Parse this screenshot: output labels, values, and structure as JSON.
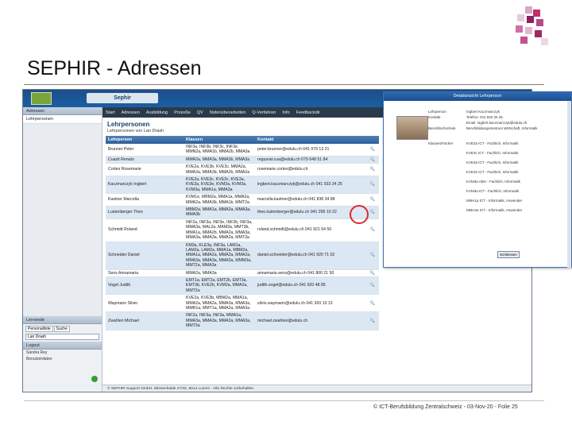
{
  "slide": {
    "title": "SEPHIR - Adressen",
    "footer": "© ICT-Berufsbildung Zentralschweiz - 03-Nov-20 - Folie 25"
  },
  "app": {
    "brand": "Sephir",
    "menu": [
      "Start",
      "Adressen",
      "Ausbildung",
      "Prozeße",
      "QV",
      "Notenüberarbeiten",
      "Q-Verfahren",
      "Info",
      "Feedbackdir"
    ],
    "left_header_addresses": "Adressen",
    "left_item": "Lehrpersonen",
    "left_header_lernende": "Lernende",
    "left_tabs": [
      "Personalliste",
      "Suche"
    ],
    "left_select_value": "Lan Drash",
    "left_header_logout": "Logout",
    "left_small_1": "Sandra Rey",
    "left_small_2": "Benutzerdaten",
    "content_title": "Lehrpersonen",
    "content_subtitle": "Lehrpersonen von Lan Drash",
    "table_headers": [
      "Lehrperson",
      "Klassen",
      "Kontakt",
      ""
    ],
    "rows": [
      {
        "name": "Brunner Peter",
        "klassen": "INF3a, INF3b, INF3c, INF3e, MMN2a, MMA1b, MMA2b, MMA3a",
        "kontakt": "peter.brunner@edulu.ch 041 979 13 21"
      },
      {
        "name": "Cuazit Renato",
        "klassen": "MMA2a, MMA3a, MMA3b, MMA3a",
        "kontakt": "regusrat.cua@edulu.ch 079 648 51 84"
      },
      {
        "name": "Cortes Rosemarie",
        "klassen": "KVE2a, KVE3b, KVE3c, MMA2a, MMA3a, MMA3b, MMA2b, MMA2a",
        "kontakt": "rosemarie.cortes@edulu.ch"
      },
      {
        "name": "Kaczmarczyk Ingbert",
        "klassen": "KVE2a, KVE3c, KVE3c, KVE3a, KVE3a, KVE3e, KVM3a, KVM3a, KVM3a, MMA1a, MMA3a",
        "kontakt": "ingbert.kaczmarczyk@edulu.ch 041 933 34 25"
      },
      {
        "name": "Kastner Marcella",
        "klassen": "KVM1e, MBM2a, MMA1a, MMA2a, MMA2a, MMA3b, MMA1b, MMT2a",
        "kontakt": "marcella.kastner@edulu.ch 041 838 34 88"
      },
      {
        "name": "Lustenberger Theo",
        "klassen": "MBM2a, MMA1a, MMA2a, MMA3a, MMA3b",
        "kontakt": "theo.lustenberger@edulu.ch 041 299 10 22"
      },
      {
        "name": "Schmidt Roland",
        "klassen": "INF2a, INF3a, INF3e, INF2b, INF3a, MMA3a, MAL2a, MAM3a, MMT3b, MMA1a, MMA2b, MMA2a, MMA3a, MMA3a, MMA3a, MMA2a, MMT3a",
        "kontakt": "roland.schmidt@edulu.ch 041 921 64 50"
      },
      {
        "name": "Schneider Daniel",
        "klassen": "KM3a, KLE3a, INF3a, LAM1a, LAM2a, LAM2a, MMA1a, MBM2a, MMA1a, MMA2a, MMA2a, MMA2a, MMA3a, MMA3a, MMA3a, MMM3a, MMT2a, MMA3a",
        "kontakt": "daniel.schneider@edulu.ch 041 920 71 02"
      },
      {
        "name": "Sens Annamaria",
        "klassen": "MMA2a, MMA3a",
        "kontakt": "annamaria.sens@edulu.ch 041 800 21 50"
      },
      {
        "name": "Vogel Judith",
        "klassen": "EMT1a, EMT2a, EMT2b, EMT3a, EMT3b, KVE2b, KVM2a, MMA2a, MMT2a",
        "kontakt": "judith.vogel@edulu.ch 041 920 48 85"
      },
      {
        "name": "Waymann Silvio",
        "klassen": "KVE2a, KVE3b, MBM2a, MMA1a, MMA2a, MMA2a, MMA3a, MMA3a, MMR1a, MMT1a, MMA2a, MMA3a",
        "kontakt": "silvio.waymann@edulu.ch 041 920 10 13"
      },
      {
        "name": "Zwahlen Michael",
        "klassen": "INF2a, INF3a, INF3a, MMA1a, MMA3a, MMA3a, MMA2a, MMA3a, MMT3a",
        "kontakt": "michael.zwahlen@edulu.ch"
      }
    ],
    "status_bar": "© SEPHIR Support GmbH, Wiesenhalde 27/32, 6014 Luzern · Alle Rechte vorbehalten."
  },
  "popup": {
    "title": "Detailansicht Lehrperson",
    "fields": [
      {
        "label": "Lehrperson",
        "value": "Ingbert Kaczmarczyk"
      },
      {
        "label": "Kontakt",
        "value": "Telefon: 041 933 34 25"
      },
      {
        "label": "",
        "value": "Email: ingbert.kaczmarczyk@edulu.ch"
      },
      {
        "label": "Berufsfachschule",
        "value": "Berufsbildungszentrum Wirtschaft, Informatik"
      },
      {
        "label": "Klassen/Fächer",
        "value": "KVE2a  ICT - Fachlich, Informatik"
      },
      {
        "label": "",
        "value": "KVE3c  ICT - Fachlich, Informatik"
      },
      {
        "label": "",
        "value": "KVE3a  ICT - Fachlich, Informatik"
      },
      {
        "label": "",
        "value": "KVE3e  ICT - Fachlich, Informatik"
      },
      {
        "label": "",
        "value": "KVM3a  ABU - Fachlich, Informatik"
      },
      {
        "label": "",
        "value": "KVM3a  ICT - Fachlich, Informatik"
      },
      {
        "label": "",
        "value": "MMA1a  ICT - Informatik, Anwender"
      },
      {
        "label": "",
        "value": "MMA3a  ICT - Informatik, Anwender"
      }
    ],
    "button": "Schliessen"
  },
  "colors": {
    "brand_blue": "#1d4e8a",
    "row_alt": "#dbe7f3",
    "highlight_red": "#d92b2b"
  }
}
